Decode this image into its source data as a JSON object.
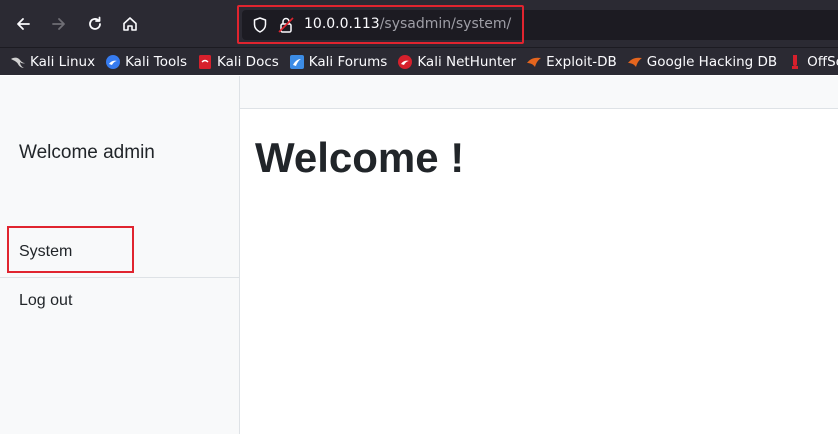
{
  "browser": {
    "url_host": "10.0.0.113",
    "url_path": "/sysadmin/system/",
    "bookmarks": [
      {
        "label": "Kali Linux",
        "icon": "kali-dragon-icon",
        "color": "#d0d0d0"
      },
      {
        "label": "Kali Tools",
        "icon": "kali-tools-icon",
        "color": "#367bf0"
      },
      {
        "label": "Kali Docs",
        "icon": "kali-docs-icon",
        "color": "#d6202c"
      },
      {
        "label": "Kali Forums",
        "icon": "kali-forums-icon",
        "color": "#3c8ce6"
      },
      {
        "label": "Kali NetHunter",
        "icon": "kali-nethunter-icon",
        "color": "#d6202c"
      },
      {
        "label": "Exploit-DB",
        "icon": "exploit-db-icon",
        "color": "#e5651e"
      },
      {
        "label": "Google Hacking DB",
        "icon": "google-hacking-db-icon",
        "color": "#e5651e"
      },
      {
        "label": "OffSec",
        "icon": "offsec-icon",
        "color": "#d6202c"
      }
    ]
  },
  "page": {
    "sidebar": {
      "welcome": "Welcome admin",
      "links": [
        {
          "label": "System"
        },
        {
          "label": "Log out"
        }
      ]
    },
    "main": {
      "title": "Welcome !"
    }
  },
  "colors": {
    "highlight": "#e0242f",
    "toolbar": "#2b2a33"
  }
}
